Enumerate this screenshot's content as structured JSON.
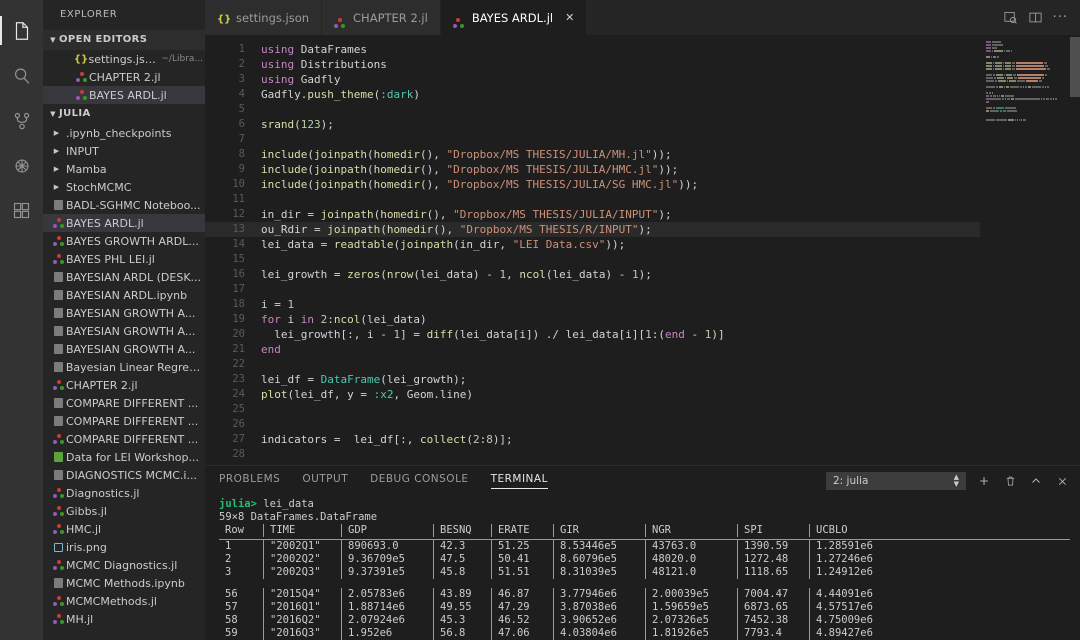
{
  "activity_bar": {
    "items": [
      {
        "name": "explorer-icon",
        "title": "Explorer",
        "active": true
      },
      {
        "name": "search-icon",
        "title": "Search",
        "active": false
      },
      {
        "name": "source-control-icon",
        "title": "Source Control",
        "active": false
      },
      {
        "name": "debug-icon",
        "title": "Run and Debug",
        "active": false
      },
      {
        "name": "extensions-icon",
        "title": "Extensions",
        "active": false
      }
    ]
  },
  "sidebar": {
    "title": "EXPLORER",
    "open_editors": {
      "label": "OPEN EDITORS",
      "items": [
        {
          "label": "settings.json",
          "sub": "~/Libra...",
          "icon": "json",
          "selected": false
        },
        {
          "label": "CHAPTER 2.jl",
          "sub": "",
          "icon": "julia",
          "selected": false
        },
        {
          "label": "BAYES ARDL.jl",
          "sub": "",
          "icon": "julia",
          "selected": true
        }
      ]
    },
    "folder": {
      "label": "JULIA",
      "items": [
        {
          "label": ".ipynb_checkpoints",
          "icon": "folder",
          "selected": false
        },
        {
          "label": "INPUT",
          "icon": "folder",
          "selected": false
        },
        {
          "label": "Mamba",
          "icon": "folder",
          "selected": false
        },
        {
          "label": "StochMCMC",
          "icon": "folder",
          "selected": false
        },
        {
          "label": "BADL-SGHMC Noteboo...",
          "icon": "notebook",
          "selected": false
        },
        {
          "label": "BAYES ARDL.jl",
          "icon": "julia",
          "selected": true
        },
        {
          "label": "BAYES GROWTH ARDL...",
          "icon": "julia",
          "selected": false
        },
        {
          "label": "BAYES PHL LEI.jl",
          "icon": "julia",
          "selected": false
        },
        {
          "label": "BAYESIAN ARDL (DESK...",
          "icon": "notebook",
          "selected": false
        },
        {
          "label": "BAYESIAN ARDL.ipynb",
          "icon": "notebook",
          "selected": false
        },
        {
          "label": "BAYESIAN GROWTH A...",
          "icon": "notebook",
          "selected": false
        },
        {
          "label": "BAYESIAN GROWTH A...",
          "icon": "notebook",
          "selected": false
        },
        {
          "label": "BAYESIAN GROWTH A...",
          "icon": "notebook",
          "selected": false
        },
        {
          "label": "Bayesian Linear Regres...",
          "icon": "notebook",
          "selected": false
        },
        {
          "label": "CHAPTER 2.jl",
          "icon": "julia",
          "selected": false
        },
        {
          "label": "COMPARE DIFFERENT ...",
          "icon": "notebook",
          "selected": false
        },
        {
          "label": "COMPARE DIFFERENT ...",
          "icon": "notebook",
          "selected": false
        },
        {
          "label": "COMPARE DIFFERENT ...",
          "icon": "julia",
          "selected": false
        },
        {
          "label": "Data for LEI Workshop...",
          "icon": "excel",
          "selected": false
        },
        {
          "label": "DIAGNOSTICS MCMC.i...",
          "icon": "notebook",
          "selected": false
        },
        {
          "label": "Diagnostics.jl",
          "icon": "julia",
          "selected": false
        },
        {
          "label": "Gibbs.jl",
          "icon": "julia",
          "selected": false
        },
        {
          "label": "HMC.jl",
          "icon": "julia",
          "selected": false
        },
        {
          "label": "iris.png",
          "icon": "png",
          "selected": false
        },
        {
          "label": "MCMC Diagnostics.jl",
          "icon": "julia",
          "selected": false
        },
        {
          "label": "MCMC Methods.ipynb",
          "icon": "notebook",
          "selected": false
        },
        {
          "label": "MCMCMethods.jl",
          "icon": "julia",
          "selected": false
        },
        {
          "label": "MH.jl",
          "icon": "julia",
          "selected": false
        }
      ]
    }
  },
  "tabs": {
    "items": [
      {
        "label": "settings.json",
        "icon": "json",
        "active": false,
        "closable": false
      },
      {
        "label": "CHAPTER 2.jl",
        "icon": "julia",
        "active": false,
        "closable": false
      },
      {
        "label": "BAYES ARDL.jl",
        "icon": "julia",
        "active": true,
        "closable": true
      }
    ],
    "close_glyph": "✕",
    "actions": [
      {
        "name": "split-editor-preview-icon"
      },
      {
        "name": "split-editor-icon"
      },
      {
        "name": "more-actions-icon",
        "glyph": "···"
      }
    ]
  },
  "editor": {
    "filename": "BAYES ARDL.jl",
    "lines": [
      {
        "n": 1,
        "tokens": [
          {
            "t": "using ",
            "c": "kw"
          },
          {
            "t": "DataFrames",
            "c": "op"
          }
        ]
      },
      {
        "n": 2,
        "tokens": [
          {
            "t": "using ",
            "c": "kw"
          },
          {
            "t": "Distributions",
            "c": "op"
          }
        ]
      },
      {
        "n": 3,
        "tokens": [
          {
            "t": "using ",
            "c": "kw"
          },
          {
            "t": "Gadfly",
            "c": "op"
          }
        ]
      },
      {
        "n": 4,
        "tokens": [
          {
            "t": "Gadfly",
            "c": "op"
          },
          {
            "t": ".",
            "c": "op"
          },
          {
            "t": "push_theme",
            "c": "fn"
          },
          {
            "t": "(",
            "c": "op"
          },
          {
            "t": ":dark",
            "c": "sym"
          },
          {
            "t": ")",
            "c": "op"
          }
        ]
      },
      {
        "n": 5,
        "tokens": []
      },
      {
        "n": 6,
        "tokens": [
          {
            "t": "srand",
            "c": "fn"
          },
          {
            "t": "(",
            "c": "op"
          },
          {
            "t": "123",
            "c": "num"
          },
          {
            "t": ");",
            "c": "op"
          }
        ]
      },
      {
        "n": 7,
        "tokens": []
      },
      {
        "n": 8,
        "tokens": [
          {
            "t": "include",
            "c": "fn"
          },
          {
            "t": "(",
            "c": "op"
          },
          {
            "t": "joinpath",
            "c": "fn"
          },
          {
            "t": "(",
            "c": "op"
          },
          {
            "t": "homedir",
            "c": "fn"
          },
          {
            "t": "(), ",
            "c": "op"
          },
          {
            "t": "\"Dropbox/MS THESIS/JULIA/MH.jl\"",
            "c": "str"
          },
          {
            "t": "));",
            "c": "op"
          }
        ]
      },
      {
        "n": 9,
        "tokens": [
          {
            "t": "include",
            "c": "fn"
          },
          {
            "t": "(",
            "c": "op"
          },
          {
            "t": "joinpath",
            "c": "fn"
          },
          {
            "t": "(",
            "c": "op"
          },
          {
            "t": "homedir",
            "c": "fn"
          },
          {
            "t": "(), ",
            "c": "op"
          },
          {
            "t": "\"Dropbox/MS THESIS/JULIA/HMC.jl\"",
            "c": "str"
          },
          {
            "t": "));",
            "c": "op"
          }
        ]
      },
      {
        "n": 10,
        "tokens": [
          {
            "t": "include",
            "c": "fn"
          },
          {
            "t": "(",
            "c": "op"
          },
          {
            "t": "joinpath",
            "c": "fn"
          },
          {
            "t": "(",
            "c": "op"
          },
          {
            "t": "homedir",
            "c": "fn"
          },
          {
            "t": "(), ",
            "c": "op"
          },
          {
            "t": "\"Dropbox/MS THESIS/JULIA/SG HMC.jl\"",
            "c": "str"
          },
          {
            "t": "));",
            "c": "op"
          }
        ]
      },
      {
        "n": 11,
        "tokens": []
      },
      {
        "n": 12,
        "tokens": [
          {
            "t": "in_dir ",
            "c": "op"
          },
          {
            "t": "= ",
            "c": "op"
          },
          {
            "t": "joinpath",
            "c": "fn"
          },
          {
            "t": "(",
            "c": "op"
          },
          {
            "t": "homedir",
            "c": "fn"
          },
          {
            "t": "(), ",
            "c": "op"
          },
          {
            "t": "\"Dropbox/MS THESIS/JULIA/INPUT\"",
            "c": "str"
          },
          {
            "t": ");",
            "c": "op"
          }
        ]
      },
      {
        "n": 13,
        "hl": true,
        "tokens": [
          {
            "t": "ou_Rdir ",
            "c": "op"
          },
          {
            "t": "= ",
            "c": "op"
          },
          {
            "t": "joinpath",
            "c": "fn"
          },
          {
            "t": "(",
            "c": "op"
          },
          {
            "t": "homedir",
            "c": "fn"
          },
          {
            "t": "(), ",
            "c": "op"
          },
          {
            "t": "\"Dropbox/MS THESIS/R/INPUT\"",
            "c": "str"
          },
          {
            "t": ");",
            "c": "op"
          }
        ]
      },
      {
        "n": 14,
        "tokens": [
          {
            "t": "lei_data ",
            "c": "op"
          },
          {
            "t": "= ",
            "c": "op"
          },
          {
            "t": "readtable",
            "c": "fn"
          },
          {
            "t": "(",
            "c": "op"
          },
          {
            "t": "joinpath",
            "c": "fn"
          },
          {
            "t": "(in_dir, ",
            "c": "op"
          },
          {
            "t": "\"LEI Data.csv\"",
            "c": "str"
          },
          {
            "t": "));",
            "c": "op"
          }
        ]
      },
      {
        "n": 15,
        "tokens": []
      },
      {
        "n": 16,
        "tokens": [
          {
            "t": "lei_growth ",
            "c": "op"
          },
          {
            "t": "= ",
            "c": "op"
          },
          {
            "t": "zeros",
            "c": "fn"
          },
          {
            "t": "(",
            "c": "op"
          },
          {
            "t": "nrow",
            "c": "fn"
          },
          {
            "t": "(lei_data) ",
            "c": "op"
          },
          {
            "t": "- ",
            "c": "op"
          },
          {
            "t": "1",
            "c": "num"
          },
          {
            "t": ", ",
            "c": "op"
          },
          {
            "t": "ncol",
            "c": "fn"
          },
          {
            "t": "(lei_data) ",
            "c": "op"
          },
          {
            "t": "- ",
            "c": "op"
          },
          {
            "t": "1",
            "c": "num"
          },
          {
            "t": ");",
            "c": "op"
          }
        ]
      },
      {
        "n": 17,
        "tokens": []
      },
      {
        "n": 18,
        "tokens": [
          {
            "t": "i ",
            "c": "op"
          },
          {
            "t": "= ",
            "c": "op"
          },
          {
            "t": "1",
            "c": "num"
          }
        ]
      },
      {
        "n": 19,
        "tokens": [
          {
            "t": "for ",
            "c": "red"
          },
          {
            "t": "i ",
            "c": "op"
          },
          {
            "t": "in ",
            "c": "red"
          },
          {
            "t": "2",
            "c": "num"
          },
          {
            "t": ":",
            "c": "op"
          },
          {
            "t": "ncol",
            "c": "fn"
          },
          {
            "t": "(lei_data)",
            "c": "op"
          }
        ]
      },
      {
        "n": 20,
        "tokens": [
          {
            "t": "  lei_growth[:, i ",
            "c": "op"
          },
          {
            "t": "- ",
            "c": "op"
          },
          {
            "t": "1",
            "c": "num"
          },
          {
            "t": "] = ",
            "c": "op"
          },
          {
            "t": "diff",
            "c": "fn"
          },
          {
            "t": "(lei_data[i]) ./ lei_data[i][",
            "c": "op"
          },
          {
            "t": "1",
            "c": "num"
          },
          {
            "t": ":(",
            "c": "op"
          },
          {
            "t": "end ",
            "c": "red"
          },
          {
            "t": "- ",
            "c": "op"
          },
          {
            "t": "1",
            "c": "num"
          },
          {
            "t": ")]",
            "c": "op"
          }
        ]
      },
      {
        "n": 21,
        "tokens": [
          {
            "t": "end",
            "c": "red"
          }
        ]
      },
      {
        "n": 22,
        "tokens": []
      },
      {
        "n": 23,
        "tokens": [
          {
            "t": "lei_df ",
            "c": "op"
          },
          {
            "t": "= ",
            "c": "op"
          },
          {
            "t": "DataFrame",
            "c": "sym"
          },
          {
            "t": "(lei_growth);",
            "c": "op"
          }
        ]
      },
      {
        "n": 24,
        "tokens": [
          {
            "t": "plot",
            "c": "fn"
          },
          {
            "t": "(lei_df, y ",
            "c": "op"
          },
          {
            "t": "= ",
            "c": "op"
          },
          {
            "t": ":x2",
            "c": "sym"
          },
          {
            "t": ", Geom.line)",
            "c": "op"
          }
        ]
      },
      {
        "n": 25,
        "tokens": []
      },
      {
        "n": 26,
        "tokens": []
      },
      {
        "n": 27,
        "tokens": [
          {
            "t": "indicators ",
            "c": "op"
          },
          {
            "t": "=  lei_df[:, ",
            "c": "op"
          },
          {
            "t": "collect",
            "c": "fn"
          },
          {
            "t": "(",
            "c": "op"
          },
          {
            "t": "2",
            "c": "num"
          },
          {
            "t": ":",
            "c": "op"
          },
          {
            "t": "8",
            "c": "num"
          },
          {
            "t": ")];",
            "c": "op"
          }
        ]
      },
      {
        "n": 28,
        "tokens": []
      }
    ]
  },
  "panel": {
    "tabs": [
      {
        "label": "PROBLEMS",
        "active": false
      },
      {
        "label": "OUTPUT",
        "active": false
      },
      {
        "label": "DEBUG CONSOLE",
        "active": false
      },
      {
        "label": "TERMINAL",
        "active": true
      }
    ],
    "terminal_selector": "2: julia",
    "actions": [
      {
        "name": "new-terminal-icon",
        "glyph": "+"
      },
      {
        "name": "kill-terminal-icon",
        "glyph": "🗑"
      },
      {
        "name": "maximize-panel-icon",
        "glyph": "∧"
      },
      {
        "name": "close-panel-icon",
        "glyph": "✕"
      }
    ],
    "terminal": {
      "prompt": "julia>",
      "command": "lei_data",
      "result_header": "59×8 DataFrames.DataFrame",
      "columns": [
        "Row",
        "TIME",
        "GDP",
        "BESNQ",
        "ERATE",
        "GIR",
        "NGR",
        "SPI",
        "UCBLO"
      ],
      "rows_top": [
        [
          "1",
          "\"2002Q1\"",
          "890693.0",
          "42.3",
          "51.25",
          "8.53446e5",
          "43763.0",
          "1390.59",
          "1.28591e6"
        ],
        [
          "2",
          "\"2002Q2\"",
          "9.36709e5",
          "47.5",
          "50.41",
          "8.60796e5",
          "48020.0",
          "1272.48",
          "1.27246e6"
        ],
        [
          "3",
          "\"2002Q3\"",
          "9.37391e5",
          "45.8",
          "51.51",
          "8.31039e5",
          "48121.0",
          "1118.65",
          "1.24912e6"
        ]
      ],
      "rows_bottom": [
        [
          "56",
          "\"2015Q4\"",
          "2.05783e6",
          "43.89",
          "46.87",
          "3.77946e6",
          "2.00039e5",
          "7004.47",
          "4.44091e6"
        ],
        [
          "57",
          "\"2016Q1\"",
          "1.88714e6",
          "49.55",
          "47.29",
          "3.87038e6",
          "1.59659e5",
          "6873.65",
          "4.57517e6"
        ],
        [
          "58",
          "\"2016Q2\"",
          "2.07924e6",
          "45.3",
          "46.52",
          "3.90652e6",
          "2.07326e5",
          "7452.38",
          "4.75009e6"
        ],
        [
          "59",
          "\"2016Q3\"",
          "1.952e6",
          "56.8",
          "47.06",
          "4.03804e6",
          "1.81926e5",
          "7793.4",
          "4.89427e6"
        ]
      ]
    }
  },
  "colors": {
    "activity_bar_bg": "#333333",
    "sidebar_bg": "#252526",
    "editor_bg": "#1e1e1e",
    "selection_bg": "#37373d",
    "accent_green": "#25bc75"
  }
}
